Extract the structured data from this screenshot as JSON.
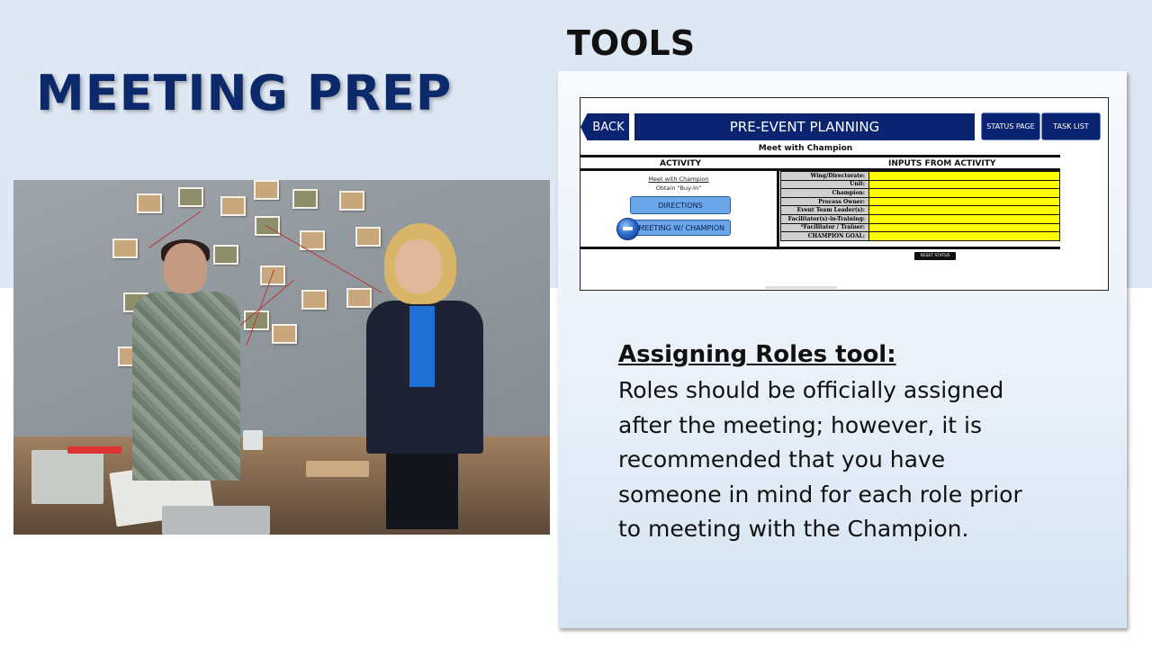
{
  "slide": {
    "title": "MEETING PREP",
    "section_title": "TOOLS"
  },
  "app": {
    "back_label": "BACK",
    "header": "PRE-EVENT PLANNING",
    "status_page_label": "STATUS PAGE",
    "task_list_label": "TASK LIST",
    "subheader": "Meet with Champion",
    "col_activity": "ACTIVITY",
    "col_inputs": "INPUTS FROM ACTIVITY",
    "activity_link": "Meet with Champion",
    "activity_sub": "Obtain \"Buy-In\"",
    "directions_label": "DIRECTIONS",
    "meeting_label": "MEETING W/ CHAMPION",
    "reset_label": "RESET STATUS",
    "fields": [
      {
        "label": "Wing/Directorate:",
        "value": ""
      },
      {
        "label": "Unit:",
        "value": ""
      },
      {
        "label": "Champion:",
        "value": ""
      },
      {
        "label": "Process Owner:",
        "value": ""
      },
      {
        "label": "Event Team Leader(s):",
        "value": ""
      },
      {
        "label": "Facilitator(s)-in-Training:",
        "value": ""
      },
      {
        "label": "*Facilitator / Trainer:",
        "value": ""
      },
      {
        "label": "CHAMPION GOAL:",
        "value": ""
      }
    ],
    "colors": {
      "navy": "#0a2472",
      "button_blue": "#6aa6e8",
      "field_yellow": "#ffff00",
      "label_gray": "#d0d0d0"
    }
  },
  "roles": {
    "title": "Assigning Roles tool:",
    "lines": [
      "Roles should be officially assigned",
      "after the meeting; however, it is",
      "recommended that you have",
      "someone in mind for each role prior",
      "to meeting with the Champion."
    ]
  }
}
